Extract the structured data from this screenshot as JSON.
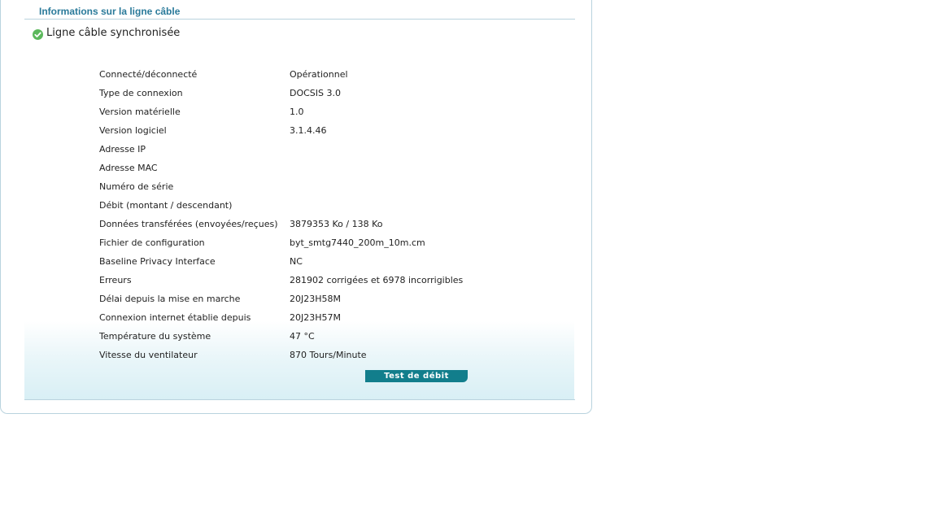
{
  "section": {
    "title": "Informations sur la ligne câble"
  },
  "status": {
    "icon": "check-circle-icon",
    "text": "Ligne câble synchronisée",
    "icon_color": "#5cb85c"
  },
  "rows": [
    {
      "label": "Connecté/déconnecté",
      "value": "Opérationnel"
    },
    {
      "label": "Type de connexion",
      "value": "DOCSIS 3.0"
    },
    {
      "label": "Version matérielle",
      "value": "1.0"
    },
    {
      "label": "Version logiciel",
      "value": "3.1.4.46"
    },
    {
      "label": "Adresse IP",
      "value": ""
    },
    {
      "label": "Adresse MAC",
      "value": ""
    },
    {
      "label": "Numéro de série",
      "value": ""
    },
    {
      "label": "Débit (montant / descendant)",
      "value": ""
    },
    {
      "label": "Données transférées (envoyées/reçues)",
      "value": "3879353 Ko / 138 Ko"
    },
    {
      "label": "Fichier de configuration",
      "value": "byt_smtg7440_200m_10m.cm"
    },
    {
      "label": "Baseline Privacy Interface",
      "value": "NC"
    },
    {
      "label": "Erreurs",
      "value": "281902 corrigées et 6978 incorrigibles"
    },
    {
      "label": "Délai depuis la mise en marche",
      "value": "20J23H58M"
    },
    {
      "label": "Connexion internet établie depuis",
      "value": "20J23H57M"
    },
    {
      "label": "Température du système",
      "value": "47 °C"
    },
    {
      "label": "Vitesse du ventilateur",
      "value": "870 Tours/Minute"
    }
  ],
  "actions": {
    "speed_test_label": "Test de débit"
  },
  "colors": {
    "accent": "#127e8c",
    "title": "#2a7a9a",
    "border": "#b9d3de"
  }
}
